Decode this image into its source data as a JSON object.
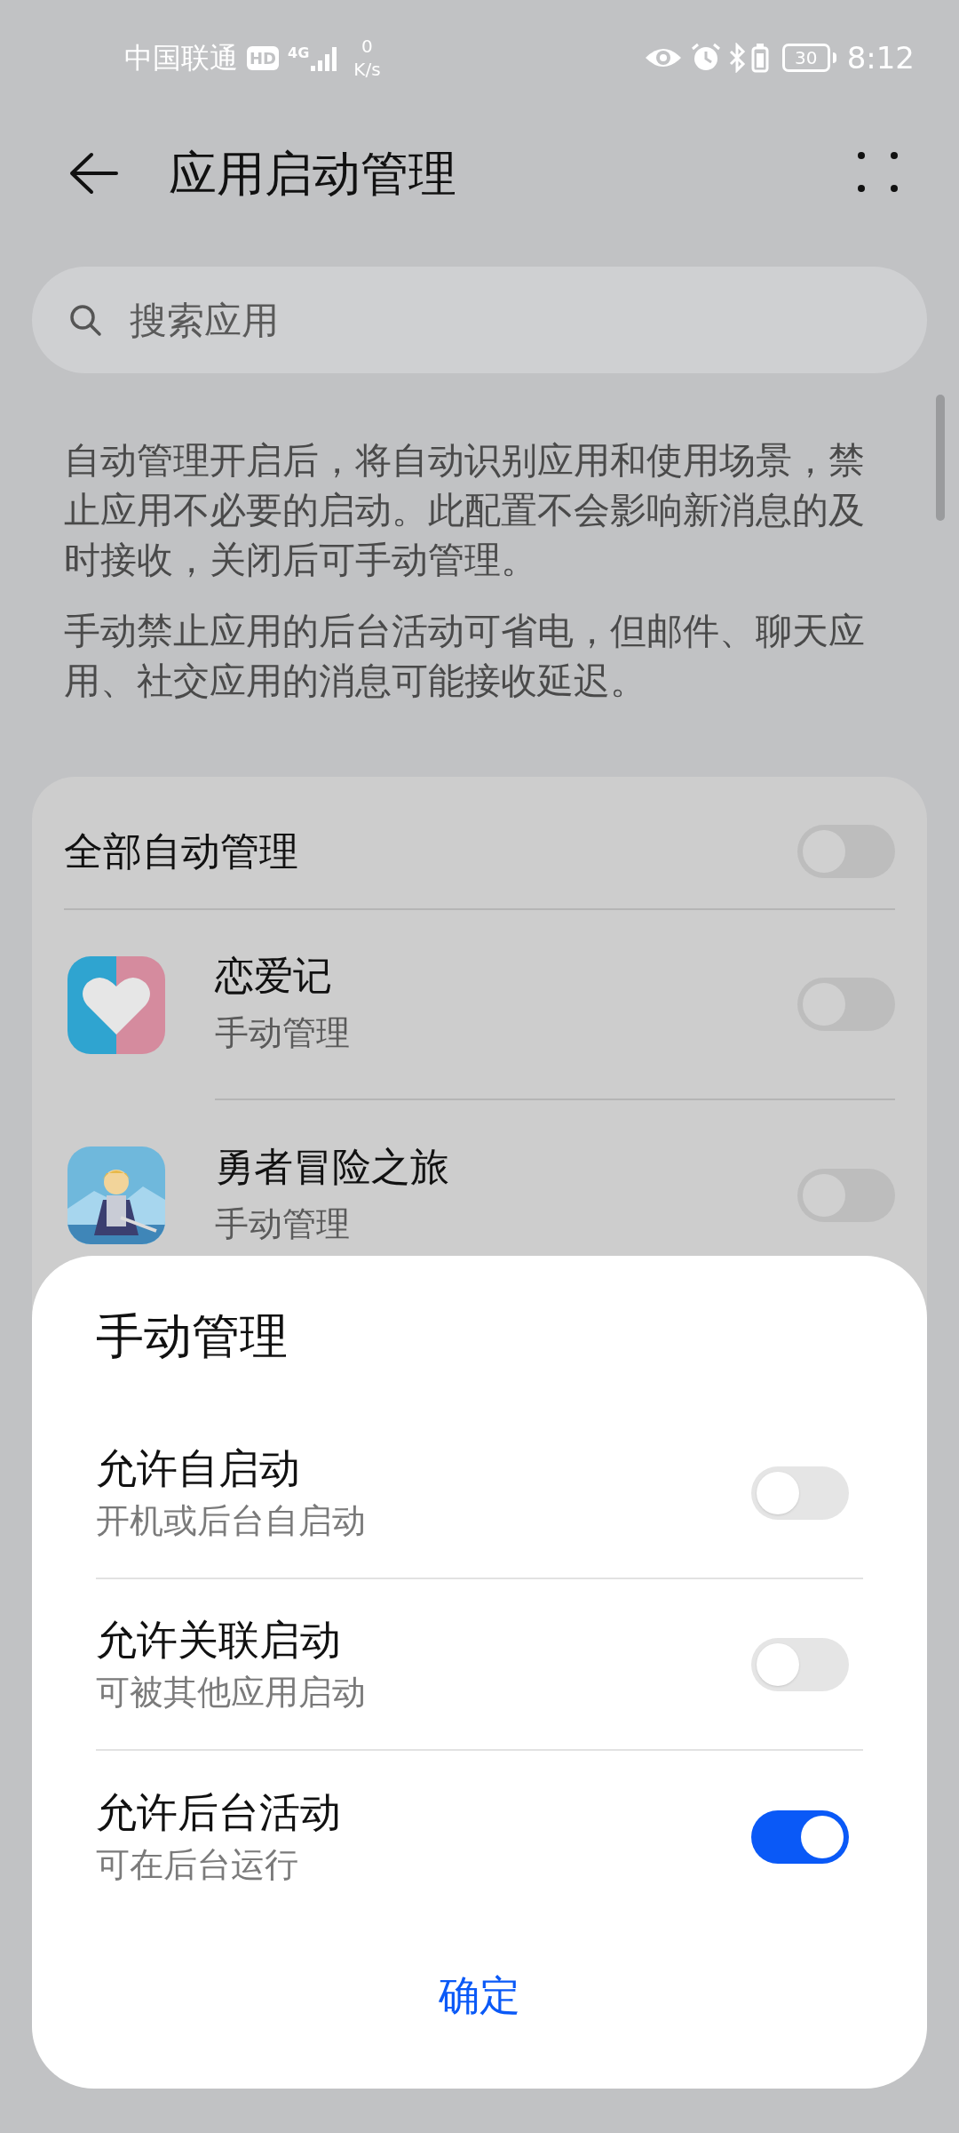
{
  "status_bar": {
    "carrier": "中国联通",
    "hd_badge": "HD",
    "network": "4G",
    "speed_value": "0",
    "speed_unit": "K/s",
    "battery": "30",
    "time": "8:12"
  },
  "header": {
    "title": "应用启动管理"
  },
  "search": {
    "placeholder": "搜索应用"
  },
  "description": [
    "自动管理开启后，将自动识别应用和使用场景，禁止应用不必要的启动。此配置不会影响新消息的及时接收，关闭后可手动管理。",
    "手动禁止应用的后台活动可省电，但邮件、聊天应用、社交应用的消息可能接收延迟。"
  ],
  "auto_all": {
    "label": "全部自动管理",
    "on": false
  },
  "apps": [
    {
      "name": "恋爱记",
      "status": "手动管理",
      "on": false,
      "kind": "heart"
    },
    {
      "name": "勇者冒险之旅",
      "status": "手动管理",
      "on": false,
      "kind": "picture"
    }
  ],
  "sheet": {
    "title": "手动管理",
    "options": [
      {
        "label": "允许自启动",
        "sublabel": "开机或后台自启动",
        "on": false
      },
      {
        "label": "允许关联启动",
        "sublabel": "可被其他应用启动",
        "on": false
      },
      {
        "label": "允许后台活动",
        "sublabel": "可在后台运行",
        "on": true
      }
    ],
    "confirm_button": "确定"
  }
}
